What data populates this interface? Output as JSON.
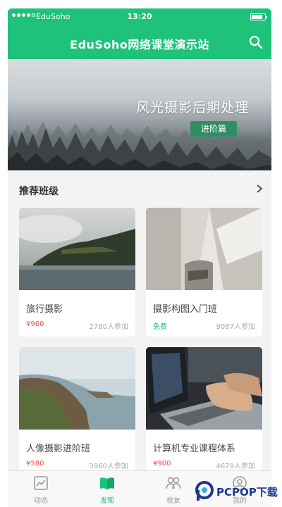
{
  "status_bar": {
    "carrier": "EduSoho",
    "time": "13:20"
  },
  "header": {
    "title": "EduSoho网络课堂演示站"
  },
  "banner": {
    "title": "风光摄影后期处理",
    "tag": "进阶篇"
  },
  "section": {
    "title": "推荐班级"
  },
  "classes": [
    {
      "title": "旅行摄影",
      "price": "¥960",
      "joined": "2780人参加"
    },
    {
      "title": "摄影构图入门班",
      "price": "免费",
      "joined": "9087人参加"
    },
    {
      "title": "人像摄影进阶班",
      "price": "¥580",
      "joined": "3960人参加"
    },
    {
      "title": "计算机专业课程体系",
      "price": "¥900",
      "joined": "4679人参加"
    }
  ],
  "tabs": [
    {
      "label": "动态",
      "icon": "activity-icon",
      "active": false
    },
    {
      "label": "发现",
      "icon": "book-icon",
      "active": true
    },
    {
      "label": "校友",
      "icon": "friends-icon",
      "active": false
    },
    {
      "label": "我的",
      "icon": "user-icon",
      "active": false
    }
  ],
  "colors": {
    "brand_green": "#1ec27a",
    "price_red": "#f24b4b",
    "tag_green": "#2f8f63"
  },
  "watermark": {
    "text": "PCPOP下载"
  }
}
